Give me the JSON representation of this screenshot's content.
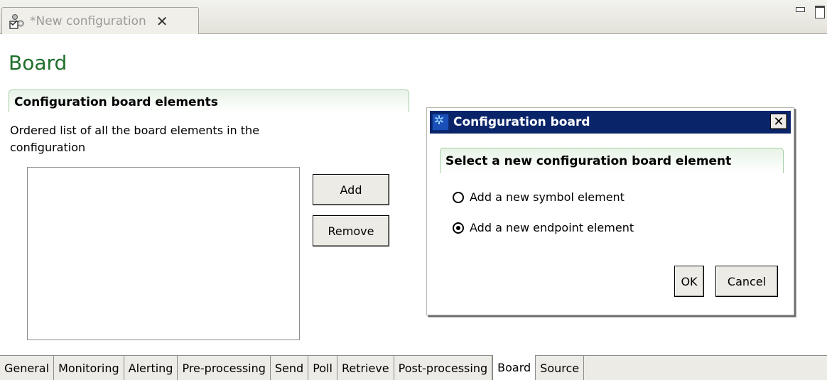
{
  "editor_tab": {
    "title": "*New configuration",
    "close_glyph": "✕"
  },
  "page": {
    "title": "Board"
  },
  "section": {
    "title": "Configuration board elements",
    "description": "Ordered list of all the board elements in the configuration",
    "add_label": "Add",
    "remove_label": "Remove",
    "list_items": []
  },
  "dialog": {
    "title": "Configuration board",
    "close_glyph": "✕",
    "section_title": "Select a new configuration board element",
    "options": [
      {
        "label": "Add a new symbol element",
        "selected": false
      },
      {
        "label": "Add a new endpoint element",
        "selected": true
      }
    ],
    "ok_label": "OK",
    "cancel_label": "Cancel"
  },
  "bottom_tabs": [
    {
      "label": "General",
      "active": false
    },
    {
      "label": "Monitoring",
      "active": false
    },
    {
      "label": "Alerting",
      "active": false
    },
    {
      "label": "Pre-processing",
      "active": false
    },
    {
      "label": "Send",
      "active": false
    },
    {
      "label": "Poll",
      "active": false
    },
    {
      "label": "Retrieve",
      "active": false
    },
    {
      "label": "Post-processing",
      "active": false
    },
    {
      "label": "Board",
      "active": true
    },
    {
      "label": "Source",
      "active": false
    }
  ],
  "colors": {
    "title_green": "#1e6f2a",
    "dialog_titlebar": "#0a246a",
    "section_border": "#a4cda4"
  }
}
